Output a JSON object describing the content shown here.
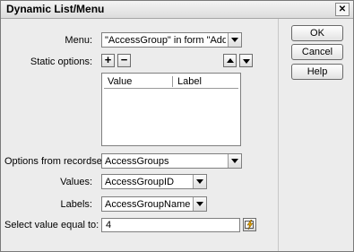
{
  "window": {
    "title": "Dynamic List/Menu",
    "close_glyph": "✕"
  },
  "menu": {
    "label": "Menu:",
    "value": "\"AccessGroup\" in form \"AddNewUser\""
  },
  "static_options": {
    "label": "Static options:",
    "add_glyph": "+",
    "remove_glyph": "−",
    "columns": [
      "Value",
      "Label"
    ]
  },
  "recordset": {
    "label": "Options from recordset:",
    "value": "AccessGroups"
  },
  "values_field": {
    "label": "Values:",
    "value": "AccessGroupID"
  },
  "labels_field": {
    "label": "Labels:",
    "value": "AccessGroupName"
  },
  "select_value": {
    "label": "Select value equal to:",
    "value": "4"
  },
  "buttons": {
    "ok": "OK",
    "cancel": "Cancel",
    "help": "Help"
  }
}
